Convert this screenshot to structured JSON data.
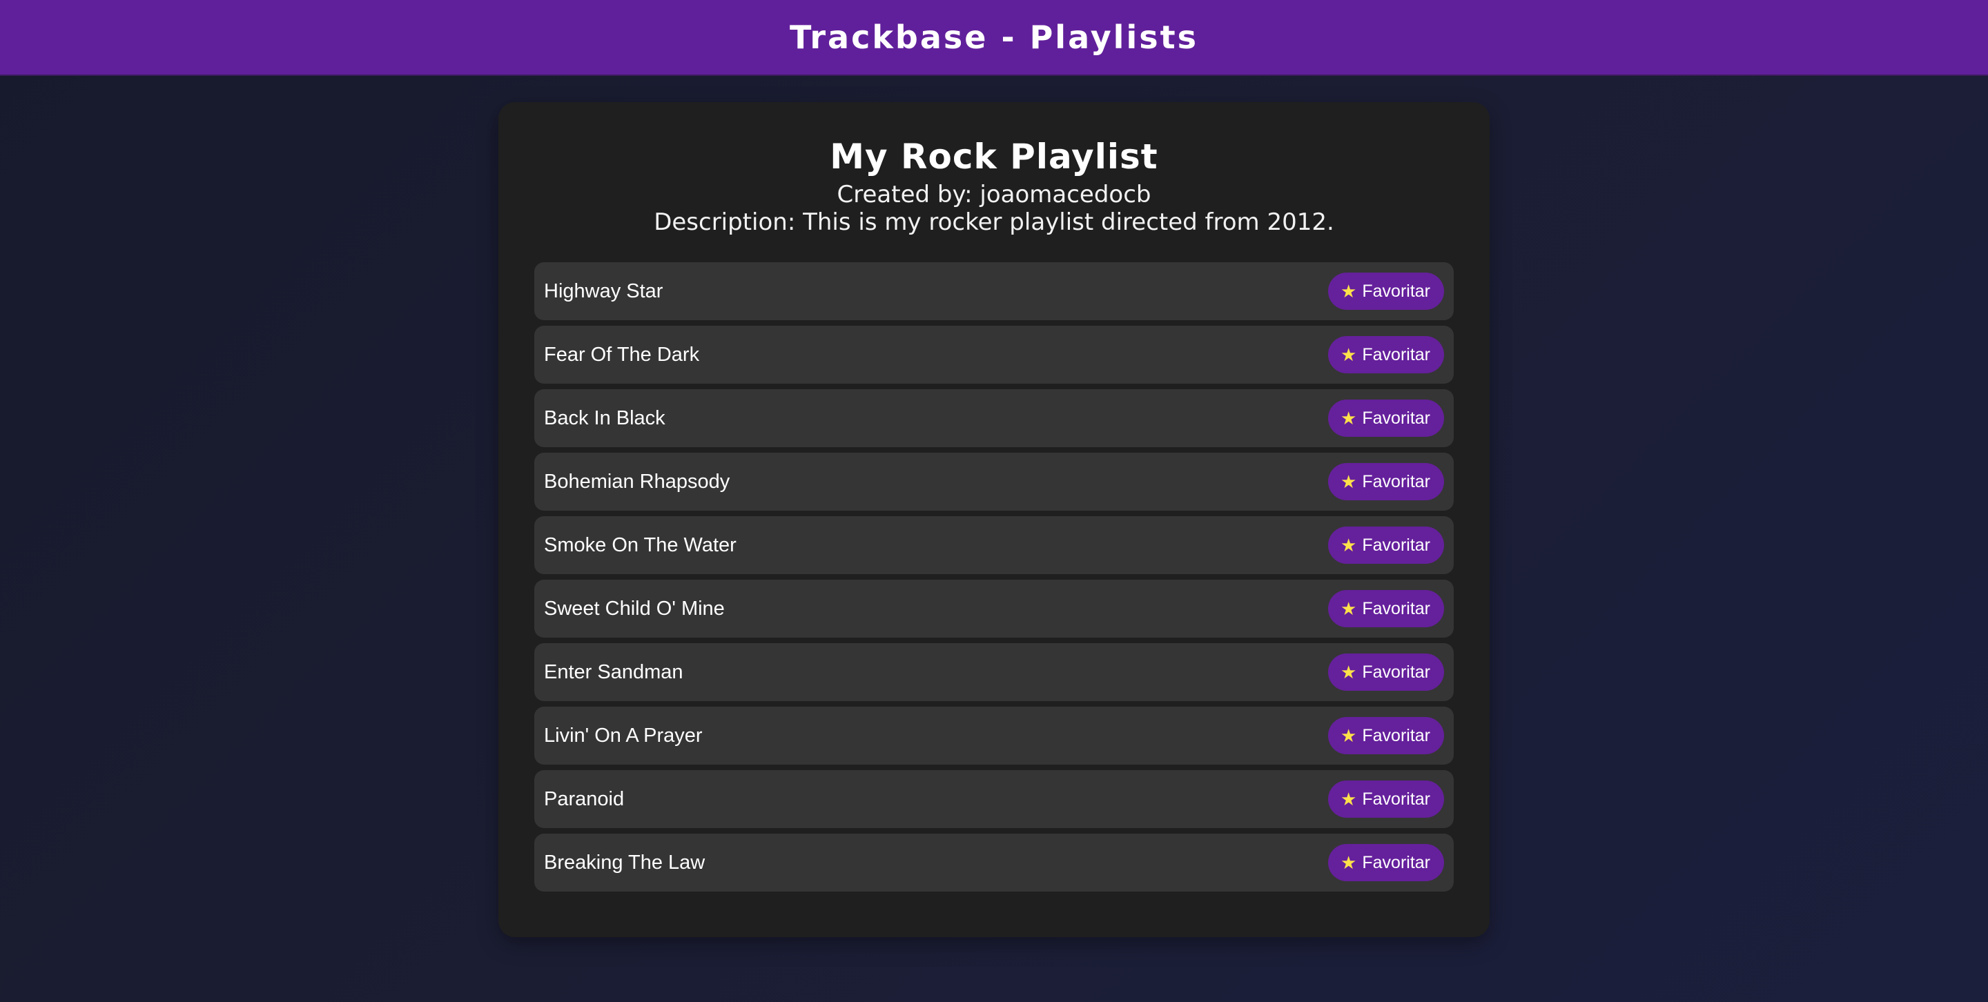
{
  "header": {
    "title": "Trackbase - Playlists"
  },
  "playlist": {
    "title": "My Rock Playlist",
    "creator": "Created by: joaomacedocb",
    "description": "Description: This is my rocker playlist directed from 2012."
  },
  "tracks": [
    {
      "title": "Highway Star",
      "button_label": "Favoritar",
      "button_icon": "star-icon"
    },
    {
      "title": "Fear Of The Dark",
      "button_label": "Favoritar",
      "button_icon": "star-icon"
    },
    {
      "title": "Back In Black",
      "button_label": "Favoritar",
      "button_icon": "star-icon"
    },
    {
      "title": "Bohemian Rhapsody",
      "button_label": "Favoritar",
      "button_icon": "star-icon"
    },
    {
      "title": "Smoke On The Water",
      "button_label": "Favoritar",
      "button_icon": "star-icon"
    },
    {
      "title": "Sweet Child O' Mine",
      "button_label": "Favoritar",
      "button_icon": "star-icon"
    },
    {
      "title": "Enter Sandman",
      "button_label": "Favoritar",
      "button_icon": "star-icon"
    },
    {
      "title": "Livin' On A Prayer",
      "button_label": "Favoritar",
      "button_icon": "star-icon"
    },
    {
      "title": "Paranoid",
      "button_label": "Favoritar",
      "button_icon": "star-icon"
    },
    {
      "title": "Breaking The Law",
      "button_label": "Favoritar",
      "button_icon": "star-icon"
    }
  ],
  "colors": {
    "header_bg": "#61209b",
    "page_bg": "#1b1d33",
    "panel_bg": "#1f1f1f",
    "row_bg": "#353535",
    "button_bg": "#65209c",
    "star": "#ffe24a"
  }
}
